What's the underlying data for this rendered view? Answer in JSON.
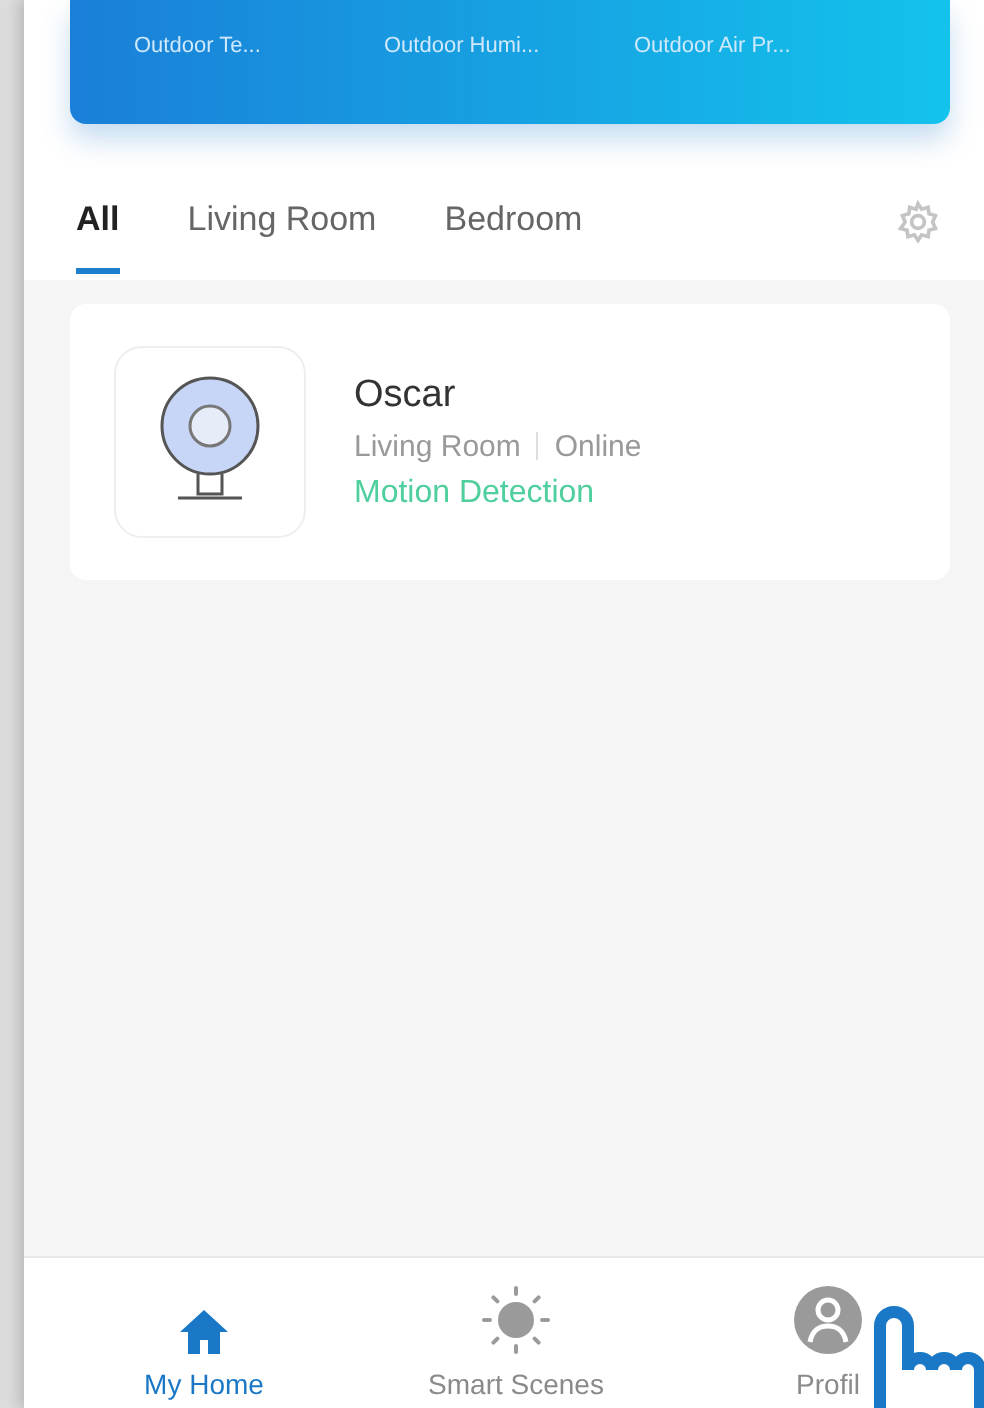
{
  "weather_card": {
    "labels": [
      "Outdoor Te...",
      "Outdoor Humi...",
      "Outdoor Air Pr..."
    ]
  },
  "room_tabs": [
    {
      "label": "All",
      "selected": true
    },
    {
      "label": "Living Room",
      "selected": false
    },
    {
      "label": "Bedroom",
      "selected": false
    }
  ],
  "devices": [
    {
      "name": "Oscar",
      "room": "Living Room",
      "status": "Online",
      "event": "Motion Detection"
    }
  ],
  "bottom_nav": [
    {
      "label": "My Home",
      "kind": "home",
      "selected": true
    },
    {
      "label": "Smart Scenes",
      "kind": "scenes",
      "selected": false
    },
    {
      "label": "Profil",
      "kind": "profile",
      "selected": false
    }
  ]
}
